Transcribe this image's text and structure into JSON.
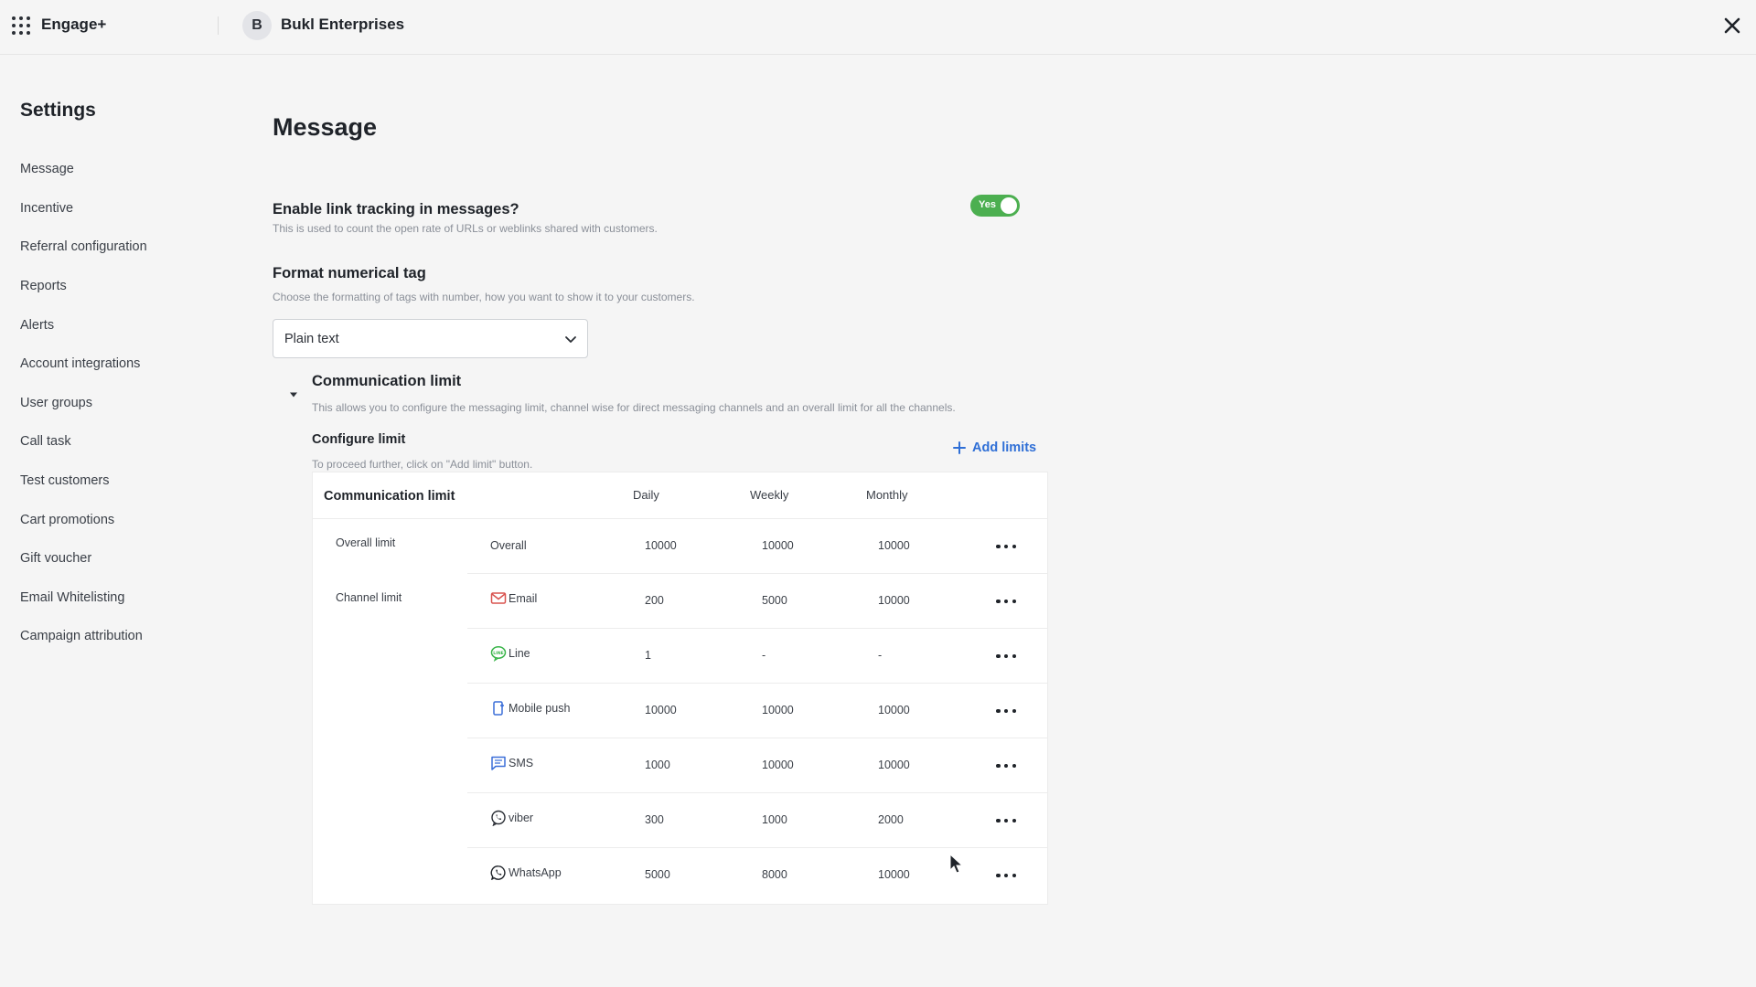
{
  "topbar": {
    "app_name": "Engage+",
    "org_initial": "B",
    "org_name": "Bukl Enterprises"
  },
  "sidebar": {
    "title": "Settings",
    "items": [
      {
        "label": "Message"
      },
      {
        "label": "Incentive"
      },
      {
        "label": "Referral configuration"
      },
      {
        "label": "Reports"
      },
      {
        "label": "Alerts"
      },
      {
        "label": "Account integrations"
      },
      {
        "label": "User groups"
      },
      {
        "label": "Call task"
      },
      {
        "label": "Test customers"
      },
      {
        "label": "Cart promotions"
      },
      {
        "label": "Gift voucher"
      },
      {
        "label": "Email Whitelisting"
      },
      {
        "label": "Campaign attribution"
      }
    ]
  },
  "main": {
    "title": "Message",
    "link_tracking": {
      "title": "Enable link tracking in messages?",
      "description": "This is used to count the open rate of URLs or weblinks shared with customers.",
      "toggle_label": "Yes",
      "enabled": true
    },
    "format_tag": {
      "title": "Format numerical tag",
      "description": "Choose the formatting of tags with number, how you want to show it to your customers.",
      "selected": "Plain text"
    },
    "comm_limit": {
      "title": "Communication limit",
      "description": "This allows you to configure the messaging limit, channel wise for direct messaging channels and an overall limit for all the channels.",
      "configure_title": "Configure limit",
      "configure_desc": "To proceed further, click on \"Add limit\" button.",
      "add_label": "Add limits"
    },
    "table": {
      "headers": {
        "main": "Communication limit",
        "daily": "Daily",
        "weekly": "Weekly",
        "monthly": "Monthly"
      },
      "overall_label": "Overall limit",
      "channel_label": "Channel limit",
      "rows": [
        {
          "name": "Overall",
          "icon": "",
          "daily": "10000",
          "weekly": "10000",
          "monthly": "10000"
        },
        {
          "name": "Email",
          "icon": "email-icon",
          "daily": "200",
          "weekly": "5000",
          "monthly": "10000"
        },
        {
          "name": "Line",
          "icon": "line-icon",
          "daily": "1",
          "weekly": "-",
          "monthly": "-"
        },
        {
          "name": "Mobile push",
          "icon": "mobile-push-icon",
          "daily": "10000",
          "weekly": "10000",
          "monthly": "10000"
        },
        {
          "name": "SMS",
          "icon": "sms-icon",
          "daily": "1000",
          "weekly": "10000",
          "monthly": "10000"
        },
        {
          "name": "viber",
          "icon": "viber-icon",
          "daily": "300",
          "weekly": "1000",
          "monthly": "2000"
        },
        {
          "name": "WhatsApp",
          "icon": "whatsapp-icon",
          "daily": "5000",
          "weekly": "8000",
          "monthly": "10000"
        }
      ]
    }
  },
  "colors": {
    "accent_green": "#4caf50",
    "link_blue": "#2f6fd6",
    "email_red": "#d9534f",
    "line_green": "#3ab54a",
    "icon_blue": "#3b6fd8"
  }
}
